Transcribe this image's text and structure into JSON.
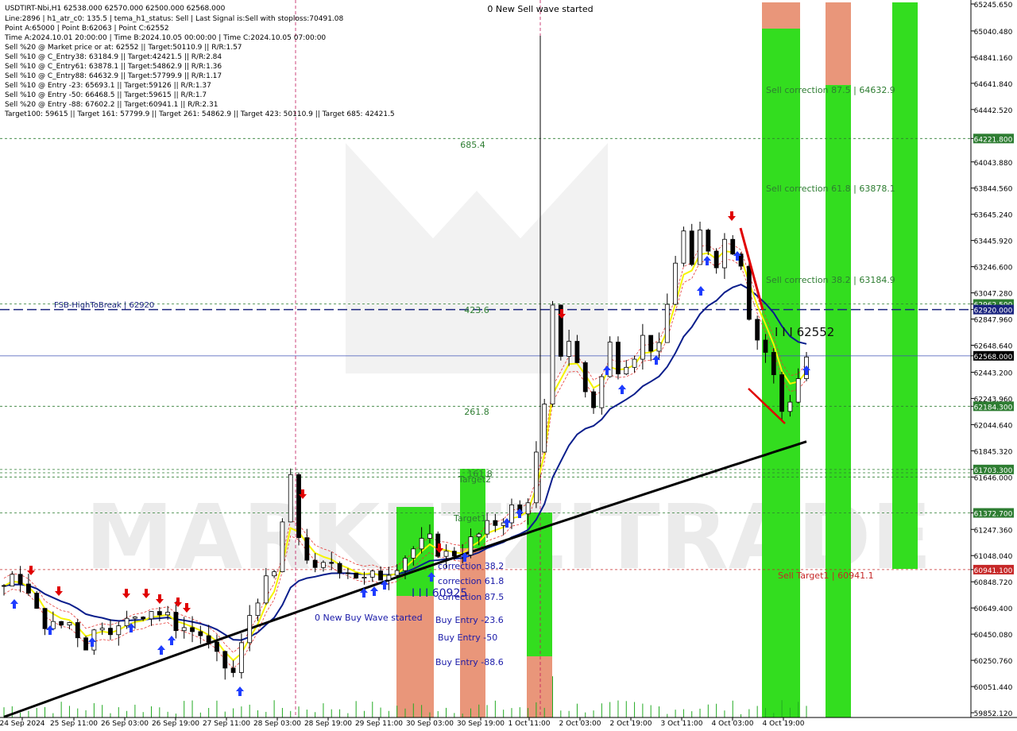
{
  "chart_data": {
    "type": "candlestick",
    "symbol_header": "USDTIRT-Nbi,H1  62538.000 62570.000 62500.000 62568.000",
    "info_lines": [
      "Line:2896 | h1_atr_c0: 135.5 | tema_h1_status: Sell | Last Signal is:Sell with stoploss:70491.08",
      "Point A:65000 | Point B:62063 | Point C:62552",
      "Time A:2024.10.01 20:00:00 | Time B:2024.10.05 00:00:00 | Time C:2024.10.05 07:00:00",
      "Sell %20 @ Market price or at: 62552 || Target:50110.9 || R/R:1.57",
      "Sell %10 @ C_Entry38: 63184.9 || Target:42421.5 || R/R:2.84",
      "Sell %10 @ C_Entry61: 63878.1 || Target:54862.9 || R/R:1.36",
      "Sell %10 @ C_Entry88: 64632.9 || Target:57799.9 || R/R:1.17",
      "Sell %10 @ Entry -23: 65693.1 || Target:59126 || R/R:1.37",
      "Sell %10 @ Entry -50: 66468.5 || Target:59615 || R/R:1.7",
      "Sell %20 @ Entry -88: 67602.2 || Target:60941.1 || R/R:2.31",
      "Target100: 59615 || Target 161: 57799.9 || Target 261: 54862.9 || Target 423: 50110.9 || Target 685: 42421.5"
    ],
    "y_range": [
      59852.12,
      65245.65
    ],
    "y_ticks": [
      65245.65,
      65040.48,
      64841.16,
      64641.84,
      64442.52,
      64221.8,
      64043.88,
      63844.56,
      63645.24,
      63445.92,
      63246.6,
      63047.28,
      62962.5,
      62920.0,
      62847.96,
      62648.64,
      62568.0,
      62443.2,
      62243.96,
      62184.3,
      62044.64,
      61845.32,
      61703.3,
      61646.0,
      61372.7,
      61247.36,
      61048.04,
      60941.1,
      60848.72,
      60649.4,
      60450.08,
      60250.76,
      60051.44,
      59852.12
    ],
    "y_tick_labels": [
      "65245.650",
      "65040.480",
      "64841.160",
      "64641.840",
      "64442.520",
      "64221.800",
      "64043.880",
      "63844.560",
      "63645.240",
      "63445.920",
      "63246.600",
      "63047.280",
      "62962.500",
      "62920.000",
      "62847.960",
      "62648.640",
      "62568.000",
      "62443.200",
      "62243.960",
      "62184.300",
      "62044.640",
      "61845.320",
      "61703.300",
      "61646.000",
      "61372.700",
      "61247.360",
      "61048.040",
      "60941.100",
      "60848.720",
      "60649.400",
      "60450.080",
      "60250.760",
      "60051.440",
      "59852.120"
    ],
    "highlighted_price_labels": [
      {
        "value": 64221.8,
        "label": "64221.800",
        "color": "#2e7d32"
      },
      {
        "value": 62962.5,
        "label": "62962.500",
        "color": "#2e7d32"
      },
      {
        "value": 62920.0,
        "label": "62920.000",
        "color": "#1a237e"
      },
      {
        "value": 62568.0,
        "label": "62568.000",
        "color": "#ffffff"
      },
      {
        "value": 62184.3,
        "label": "62184.300",
        "color": "#2e7d32"
      },
      {
        "value": 61703.3,
        "label": "61703.300",
        "color": "#2e7d32"
      },
      {
        "value": 61372.7,
        "label": "61372.700",
        "color": "#2e7d32"
      },
      {
        "value": 60941.1,
        "label": "60941.100",
        "color": "#c62828"
      }
    ],
    "x_labels": [
      "24 Sep 2024",
      "25 Sep 11:00",
      "26 Sep 03:00",
      "26 Sep 19:00",
      "27 Sep 11:00",
      "28 Sep 03:00",
      "28 Sep 19:00",
      "29 Sep 11:00",
      "30 Sep 03:00",
      "30 Sep 19:00",
      "1 Oct 11:00",
      "2 Oct 03:00",
      "2 Oct 19:00",
      "3 Oct 11:00",
      "4 Oct 03:00",
      "4 Oct 19:00"
    ],
    "close_path": [
      [
        0,
        60820
      ],
      [
        2,
        60880
      ],
      [
        4,
        60600
      ],
      [
        6,
        60500
      ],
      [
        8,
        60540
      ],
      [
        10,
        60380
      ],
      [
        12,
        60550
      ],
      [
        14,
        60480
      ],
      [
        16,
        60600
      ],
      [
        18,
        60650
      ],
      [
        20,
        60560
      ],
      [
        22,
        60500
      ],
      [
        24,
        60450
      ],
      [
        26,
        60250
      ],
      [
        28,
        60150
      ],
      [
        29,
        60350
      ],
      [
        30,
        60600
      ],
      [
        31,
        60750
      ],
      [
        33,
        60900
      ],
      [
        34,
        61300
      ],
      [
        35,
        61600
      ],
      [
        36,
        61200
      ],
      [
        37,
        61050
      ],
      [
        38,
        60900
      ],
      [
        40,
        61000
      ],
      [
        42,
        60950
      ],
      [
        44,
        60850
      ],
      [
        46,
        60900
      ],
      [
        48,
        61000
      ],
      [
        50,
        61100
      ],
      [
        52,
        61150
      ],
      [
        54,
        61050
      ],
      [
        56,
        61100
      ],
      [
        58,
        61200
      ],
      [
        60,
        61300
      ],
      [
        62,
        61400
      ],
      [
        63,
        61350
      ],
      [
        64,
        61500
      ],
      [
        65,
        61800
      ],
      [
        66,
        62150
      ],
      [
        67,
        62900
      ],
      [
        68,
        62600
      ],
      [
        69,
        62700
      ],
      [
        70,
        62500
      ],
      [
        71,
        62300
      ],
      [
        72,
        62200
      ],
      [
        73,
        62400
      ],
      [
        74,
        62650
      ],
      [
        75,
        62500
      ],
      [
        76,
        62550
      ],
      [
        77,
        62600
      ],
      [
        78,
        62700
      ],
      [
        79,
        62650
      ],
      [
        80,
        62600
      ],
      [
        82,
        63300
      ],
      [
        83,
        63500
      ],
      [
        84,
        63200
      ],
      [
        85,
        63500
      ],
      [
        86,
        63400
      ],
      [
        87,
        63300
      ],
      [
        88,
        63450
      ],
      [
        89,
        63400
      ],
      [
        90,
        63300
      ],
      [
        91,
        62900
      ],
      [
        92,
        62700
      ],
      [
        93,
        62600
      ],
      [
        94,
        62400
      ],
      [
        95,
        62150
      ],
      [
        96,
        62250
      ],
      [
        97,
        62400
      ],
      [
        98,
        62560
      ]
    ],
    "num_bars": 99,
    "annotations": {
      "new_sell_wave": "0 New Sell wave started",
      "new_buy_wave": "0 New Buy Wave started",
      "fsb_label": "FSB-HighToBreak | 62920",
      "level_685": "685.4",
      "level_423": "423.6",
      "level_261": "261.8",
      "level_161": "161.8",
      "target1": "Target1",
      "target2": "Target2",
      "correction_38": "correction 38.2",
      "correction_61": "correction 61.8",
      "correction_87": "correction 87.5",
      "buy_entry_23": "Buy Entry -23.6",
      "buy_entry_50": "Buy Entry -50",
      "buy_entry_88": "Buy Entry -88.6",
      "mid_value": "I I I 60925",
      "point_c": "I I I 62552",
      "sell_corr_87": "Sell correction 87.5 | 64632.9",
      "sell_corr_61": "Sell correction 61.8 | 63878.1",
      "sell_corr_38": "Sell correction 38.2 | 63184.9",
      "sell_target": "Sell Target1 | 60941.1",
      "watermark": "MARKETZITRADE"
    },
    "colors": {
      "green_zone": "#33dd1f",
      "orange_zone": "#e9967a",
      "yellow_line": "#f5f500",
      "blue_line": "#0a1e8c",
      "black_line": "#000000",
      "red": "#e00000",
      "buy_arrow": "#1e3cff"
    }
  }
}
